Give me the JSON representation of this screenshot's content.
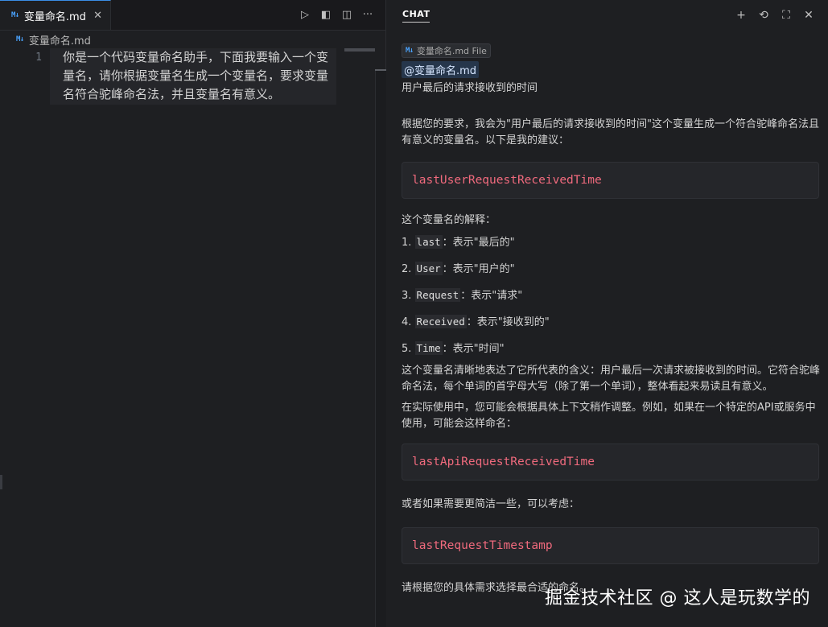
{
  "editor": {
    "tab": {
      "icon": "M↓",
      "title": "变量命名.md",
      "close": "✕"
    },
    "actions": [
      {
        "name": "run-icon",
        "glyph": "▷"
      },
      {
        "name": "preview-icon",
        "glyph": "◧"
      },
      {
        "name": "split-editor-icon",
        "glyph": "◫"
      },
      {
        "name": "more-icon",
        "glyph": "···"
      }
    ],
    "breadcrumb": {
      "icon": "M↓",
      "file": "变量命名.md"
    },
    "line_number": "1",
    "content": "你是一个代码变量命名助手，下面我要输入一个变量名，请你根据变量名生成一个变量名，要求变量名符合驼峰命名法，并且变量名有意义。"
  },
  "chat": {
    "title": "CHAT",
    "actions": [
      {
        "name": "new-chat-icon",
        "glyph": "+"
      },
      {
        "name": "history-icon",
        "glyph": "⟲"
      },
      {
        "name": "maximize-icon",
        "glyph": "⛶"
      },
      {
        "name": "close-icon",
        "glyph": "✕"
      }
    ],
    "file_chip": {
      "icon": "M↓",
      "label": "变量命名.md File"
    },
    "mention": "@变量命名.md",
    "user_message": "用户最后的请求接收到的时间",
    "response": {
      "intro": "根据您的要求，我会为\"用户最后的请求接收到的时间\"这个变量生成一个符合驼峰命名法且有意义的变量名。以下是我的建议：",
      "code1": "lastUserRequestReceivedTime",
      "explain_title": "这个变量名的解释：",
      "items": [
        {
          "num": "1.",
          "code": "last",
          "desc": "：表示\"最后的\""
        },
        {
          "num": "2.",
          "code": "User",
          "desc": "：表示\"用户的\""
        },
        {
          "num": "3.",
          "code": "Request",
          "desc": "：表示\"请求\""
        },
        {
          "num": "4.",
          "code": "Received",
          "desc": "：表示\"接收到的\""
        },
        {
          "num": "5.",
          "code": "Time",
          "desc": "：表示\"时间\""
        }
      ],
      "summary": "这个变量名清晰地表达了它所代表的含义：用户最后一次请求被接收到的时间。它符合驼峰命名法，每个单词的首字母大写（除了第一个单词），整体看起来易读且有意义。",
      "usage": "在实际使用中，您可能会根据具体上下文稍作调整。例如，如果在一个特定的API或服务中使用，可能会这样命名：",
      "code2": "lastApiRequestReceivedTime",
      "shorter": "或者如果需要更简洁一些，可以考虑：",
      "code3": "lastRequestTimestamp",
      "closing": "请根据您的具体需求选择最合适的命名。"
    },
    "watermark": "掘金技术社区 @ 这人是玩数学的"
  },
  "colors": {
    "accent": "#3a8ee6",
    "code_text": "#f06a7d",
    "background": "#1e1f22"
  }
}
